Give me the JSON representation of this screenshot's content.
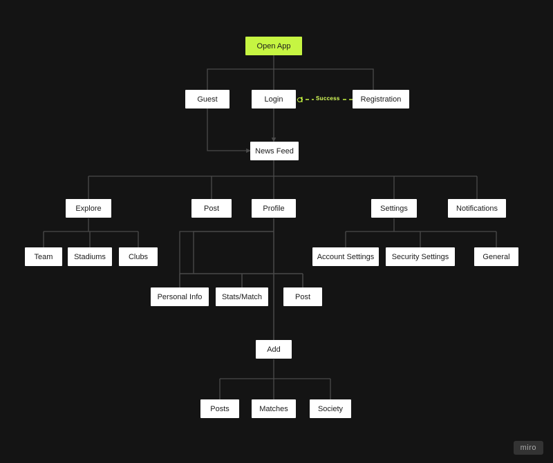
{
  "watermark": "miro",
  "colors": {
    "bg": "#141414",
    "node_bg": "#ffffff",
    "node_text": "#1a1a1a",
    "root_bg": "#c6f542",
    "connector": "#4b4b4b",
    "dashed": "#c6f542",
    "edge_label": "#d9ff5a"
  },
  "nodes": {
    "open_app": {
      "label": "Open App",
      "root": true
    },
    "guest": {
      "label": "Guest"
    },
    "login": {
      "label": "Login"
    },
    "registration": {
      "label": "Registration"
    },
    "news_feed": {
      "label": "News Feed"
    },
    "explore": {
      "label": "Explore"
    },
    "post": {
      "label": "Post"
    },
    "profile": {
      "label": "Profile"
    },
    "settings": {
      "label": "Settings"
    },
    "notifications": {
      "label": "Notifications"
    },
    "team": {
      "label": "Team"
    },
    "stadiums": {
      "label": "Stadiums"
    },
    "clubs": {
      "label": "Clubs"
    },
    "account_settings": {
      "label": "Account Settings"
    },
    "security_settings": {
      "label": "Security Settings"
    },
    "general": {
      "label": "General"
    },
    "personal_info": {
      "label": "Personal Info"
    },
    "stats_match": {
      "label": "Stats/Match"
    },
    "post2": {
      "label": "Post"
    },
    "add": {
      "label": "Add"
    },
    "posts": {
      "label": "Posts"
    },
    "matches": {
      "label": "Matches"
    },
    "society": {
      "label": "Society"
    }
  },
  "edges": {
    "success": {
      "label": "Success"
    }
  },
  "chart_data": {
    "type": "flowchart",
    "root": "open_app",
    "nodes": [
      "open_app",
      "guest",
      "login",
      "registration",
      "news_feed",
      "explore",
      "post",
      "profile",
      "settings",
      "notifications",
      "team",
      "stadiums",
      "clubs",
      "account_settings",
      "security_settings",
      "general",
      "personal_info",
      "stats_match",
      "post2",
      "add",
      "posts",
      "matches",
      "society"
    ],
    "edges": [
      {
        "from": "open_app",
        "to": "guest"
      },
      {
        "from": "open_app",
        "to": "login"
      },
      {
        "from": "open_app",
        "to": "registration"
      },
      {
        "from": "registration",
        "to": "login",
        "style": "dashed",
        "label": "Success"
      },
      {
        "from": "login",
        "to": "news_feed"
      },
      {
        "from": "guest",
        "to": "news_feed"
      },
      {
        "from": "news_feed",
        "to": "explore"
      },
      {
        "from": "news_feed",
        "to": "post"
      },
      {
        "from": "news_feed",
        "to": "profile"
      },
      {
        "from": "news_feed",
        "to": "settings"
      },
      {
        "from": "news_feed",
        "to": "notifications"
      },
      {
        "from": "explore",
        "to": "team"
      },
      {
        "from": "explore",
        "to": "stadiums"
      },
      {
        "from": "explore",
        "to": "clubs"
      },
      {
        "from": "settings",
        "to": "account_settings"
      },
      {
        "from": "settings",
        "to": "security_settings"
      },
      {
        "from": "settings",
        "to": "general"
      },
      {
        "from": "profile",
        "to": "personal_info"
      },
      {
        "from": "profile",
        "to": "stats_match"
      },
      {
        "from": "profile",
        "to": "post2"
      },
      {
        "from": "profile",
        "to": "add"
      },
      {
        "from": "add",
        "to": "posts"
      },
      {
        "from": "add",
        "to": "matches"
      },
      {
        "from": "add",
        "to": "society"
      }
    ]
  }
}
